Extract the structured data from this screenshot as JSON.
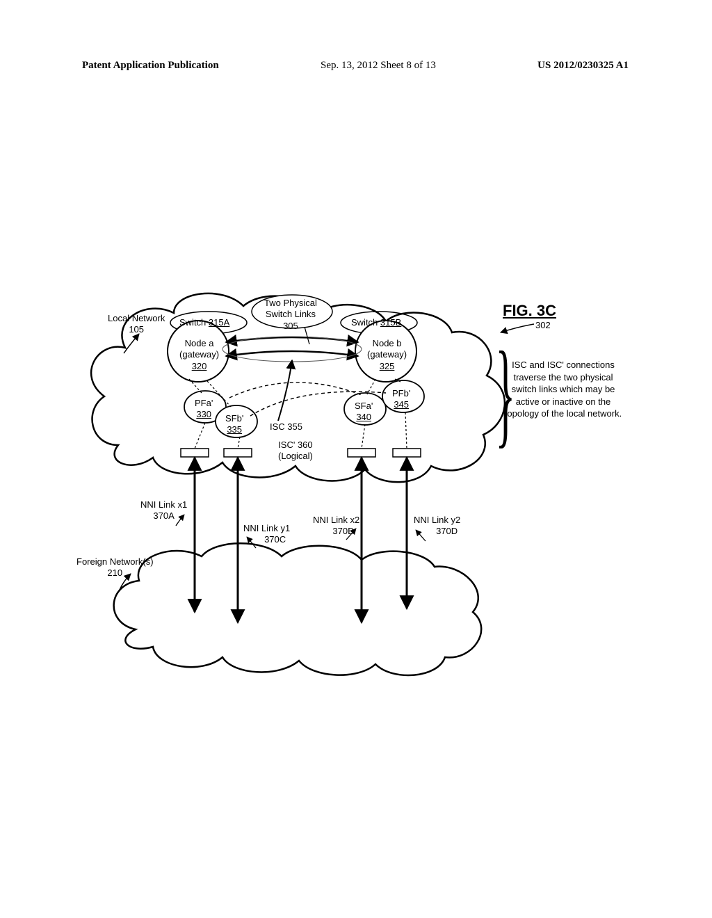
{
  "header": {
    "left": "Patent Application Publication",
    "center": "Sep. 13, 2012  Sheet 8 of 13",
    "right": "US 2012/0230325 A1"
  },
  "figure": {
    "title": "FIG. 3C",
    "ref_number": "302"
  },
  "clouds": {
    "local": {
      "label": "Local Network",
      "ref": "105"
    },
    "foreign": {
      "label": "Foreign Network(s)",
      "ref": "210"
    }
  },
  "switches": {
    "a": {
      "prefix": "Switch",
      "ref": "315A"
    },
    "b": {
      "prefix": "Switch",
      "ref": "315B"
    },
    "links": {
      "label": "Two Physical\nSwitch Links",
      "ref": "305"
    }
  },
  "nodes": {
    "a": {
      "line1": "Node a",
      "line2": "(gateway)",
      "ref": "320"
    },
    "b": {
      "line1": "Node b",
      "line2": "(gateway)",
      "ref": "325"
    }
  },
  "forwarders": {
    "pfa": {
      "label": "PFa'",
      "ref": "330"
    },
    "sfb": {
      "label": "SFb'",
      "ref": "335"
    },
    "sfa": {
      "label": "SFa'",
      "ref": "340"
    },
    "pfb": {
      "label": "PFb'",
      "ref": "345"
    }
  },
  "isc": {
    "primary": {
      "label": "ISC 355"
    },
    "logical": {
      "line1": "ISC' 360",
      "line2": "(Logical)"
    }
  },
  "nni": {
    "x1": {
      "label": "NNI Link x1",
      "ref": "370A"
    },
    "y1": {
      "label": "NNI Link y1",
      "ref": "370C"
    },
    "x2": {
      "label": "NNI Link x2",
      "ref": "370B"
    },
    "y2": {
      "label": "NNI Link y2",
      "ref": "370D"
    }
  },
  "side_note": "ISC and ISC' connections traverse the two physical switch links which may be active or inactive on the topology of the local network."
}
